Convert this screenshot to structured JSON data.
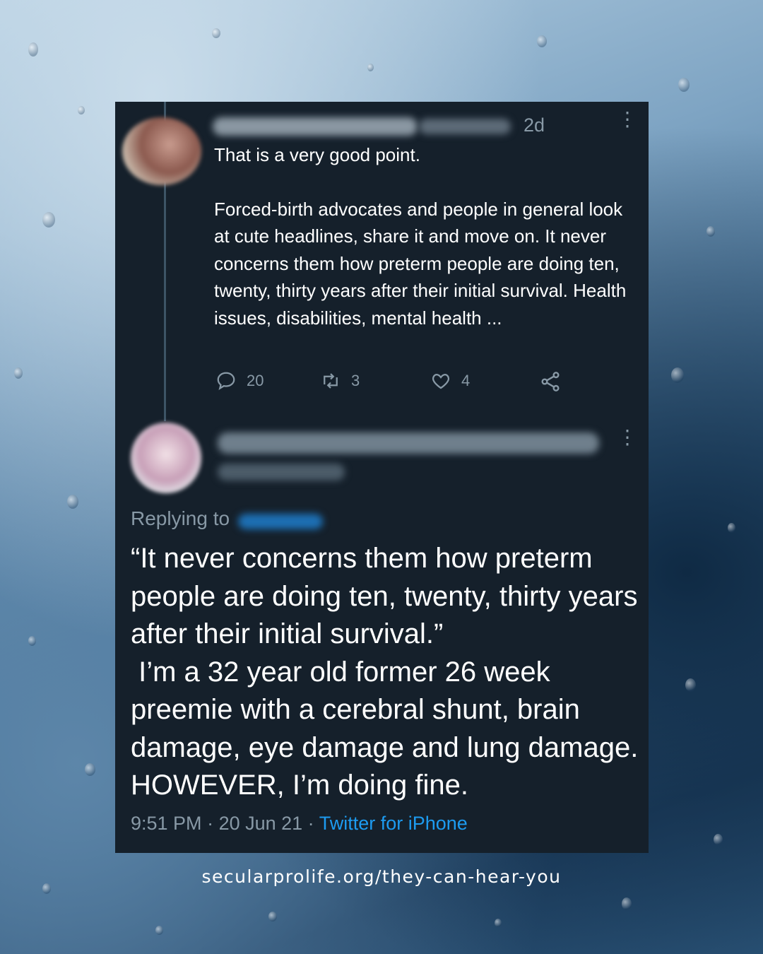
{
  "tweet1": {
    "timestamp": "2d",
    "paragraphs": [
      "That is a very good point.",
      "Forced-birth advocates and people in general look at cute headlines, share it and move on. It never concerns them how preterm people are doing ten, twenty, thirty years after their initial survival. Health issues, disabilities, mental health ..."
    ],
    "actions": {
      "replies": "20",
      "retweets": "3",
      "likes": "4"
    }
  },
  "tweet2": {
    "replying_to_label": "Replying to",
    "text": "“It never concerns them how preterm people are doing ten, twenty, thirty years after their initial survival.”\n I’m a 32 year old former 26 week preemie with a cerebral shunt, brain damage, eye damage and lung damage. HOWEVER, I’m doing fine.",
    "time": "9:51 PM",
    "date": "20 Jun 21",
    "via": "Twitter for iPhone",
    "separator": " · "
  },
  "footer": {
    "url": "secularprolife.org/they-can-hear-you"
  },
  "icons": {
    "reply": "reply-icon",
    "retweet": "retweet-icon",
    "like": "heart-icon",
    "share": "share-icon",
    "more": "more-vertical-icon"
  },
  "colors": {
    "card_bg": "#15202b",
    "muted": "#8899a6",
    "link": "#1d9bf0"
  }
}
